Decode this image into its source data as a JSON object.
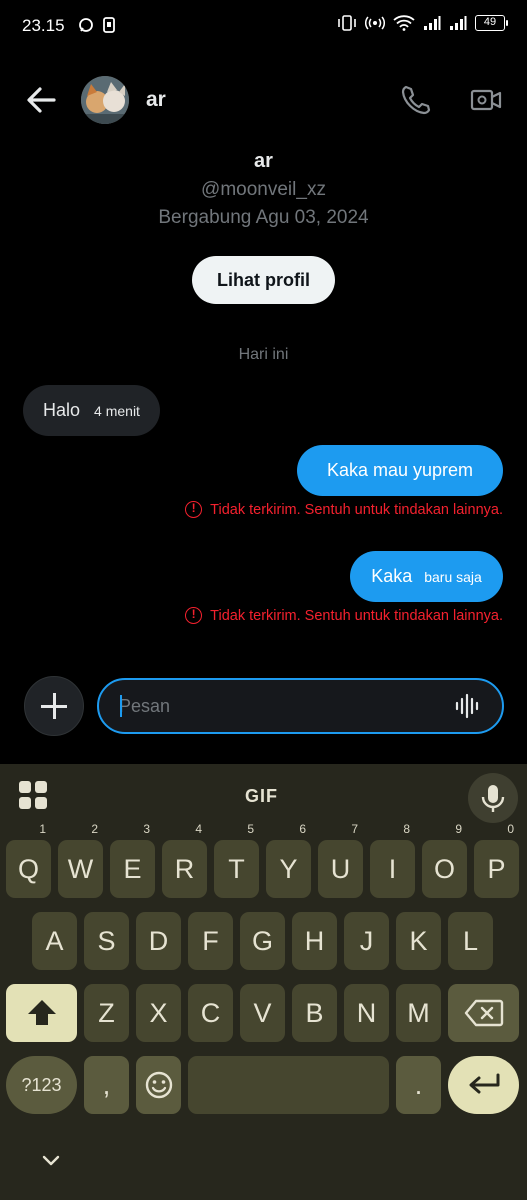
{
  "status_bar": {
    "time": "23.15",
    "battery": "49"
  },
  "chat_header": {
    "name": "ar",
    "back_icon": "arrow-left-icon",
    "call_icon": "phone-icon",
    "video_icon": "video-camera-icon"
  },
  "profile": {
    "name": "ar",
    "handle": "@moonveil_xz",
    "joined": "Bergabung Agu 03, 2024",
    "view_profile_label": "Lihat profil"
  },
  "day_separator": "Hari ini",
  "messages": [
    {
      "direction": "in",
      "text": "Halo",
      "time": "4 menit"
    },
    {
      "direction": "out",
      "text": "Kaka mau yuprem",
      "error": "Tidak terkirim. Sentuh untuk tindakan lainnya."
    },
    {
      "direction": "out",
      "text": "Kaka",
      "time": "baru saja",
      "error": "Tidak terkirim. Sentuh untuk tindakan lainnya."
    }
  ],
  "composer": {
    "placeholder": "Pesan",
    "value": ""
  },
  "keyboard": {
    "gif_label": "GIF",
    "row1": [
      "Q",
      "W",
      "E",
      "R",
      "T",
      "Y",
      "U",
      "I",
      "O",
      "P"
    ],
    "row1_hints": [
      "1",
      "2",
      "3",
      "4",
      "5",
      "6",
      "7",
      "8",
      "9",
      "0"
    ],
    "row2": [
      "A",
      "S",
      "D",
      "F",
      "G",
      "H",
      "J",
      "K",
      "L"
    ],
    "row3": [
      "Z",
      "X",
      "C",
      "V",
      "B",
      "N",
      "M"
    ],
    "symbols_label": "?123",
    "comma": ",",
    "period": ".",
    "colors": {
      "background": "#27271d",
      "key": "#46462f",
      "accent": "#e3e1b6"
    }
  },
  "colors": {
    "accent": "#1d9bf0",
    "error": "#f4212e",
    "muted": "#71767b"
  }
}
